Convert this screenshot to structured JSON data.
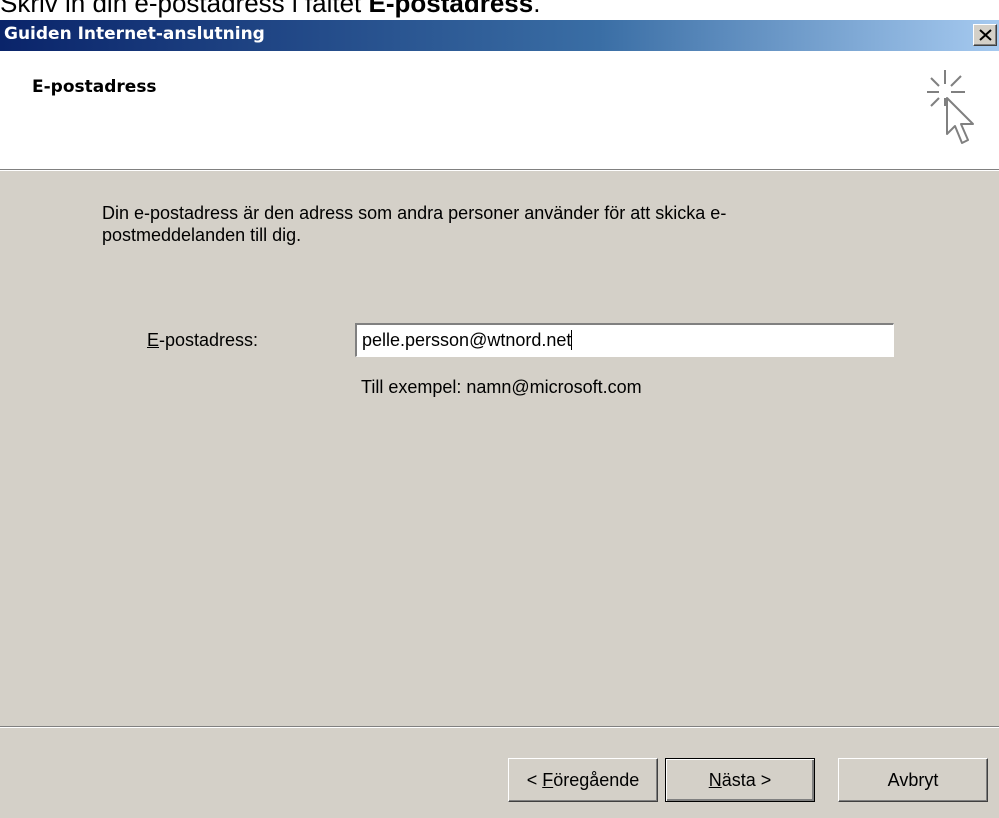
{
  "caption": {
    "text_before": "Skriv in din e-postadress i fältet ",
    "text_bold": "E-postadress",
    "text_after": "."
  },
  "window": {
    "title": "Guiden Internet-anslutning",
    "close_label": "×"
  },
  "header": {
    "title": "E-postadress",
    "icon": "wizard-cursor-icon"
  },
  "body": {
    "description": "Din e-postadress är den adress som andra personer använder för att skicka e-postmeddelanden till dig.",
    "field": {
      "label_mnemonic": "E",
      "label_rest": "-postadress:",
      "value": "pelle.persson@wtnord.net",
      "hint": "Till exempel: namn@microsoft.com"
    }
  },
  "buttons": {
    "back_prefix": "< ",
    "back_mnemonic": "F",
    "back_rest": "öregående",
    "next_mnemonic": "N",
    "next_rest": "ästa >",
    "cancel": "Avbryt"
  }
}
